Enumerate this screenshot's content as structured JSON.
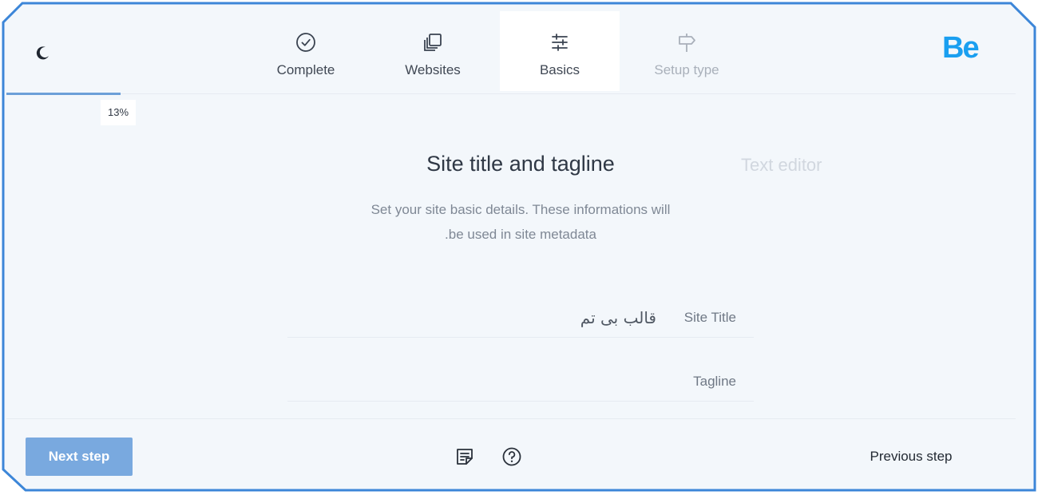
{
  "header": {
    "tabs": [
      {
        "label": "Complete",
        "icon": "check-circle-icon"
      },
      {
        "label": "Websites",
        "icon": "copies-icon"
      },
      {
        "label": "Basics",
        "icon": "sliders-icon"
      },
      {
        "label": "Setup type",
        "icon": "signpost-icon"
      }
    ],
    "active_tab": "Basics",
    "logo_text": "Be",
    "theme_icon": "moon-icon"
  },
  "progress": {
    "percent": 13,
    "label": "13%"
  },
  "main": {
    "title": "Site title and tagline",
    "alt_title": "Text editor",
    "description_line1": "Set your site basic details. These informations will",
    "description_line2": ".be used in site metadata",
    "fields": {
      "site_title": {
        "label": "Site Title",
        "value": "قالب بی تم"
      },
      "tagline": {
        "label": "Tagline",
        "value": ""
      }
    }
  },
  "footer": {
    "next_label": "Next step",
    "previous_label": "Previous step",
    "icons": [
      "notes-icon",
      "help-icon"
    ]
  },
  "colors": {
    "background": "#f3f7fb",
    "frame": "#3c86d8",
    "accent": "#79a9df",
    "logo": "#1a9ff0"
  }
}
